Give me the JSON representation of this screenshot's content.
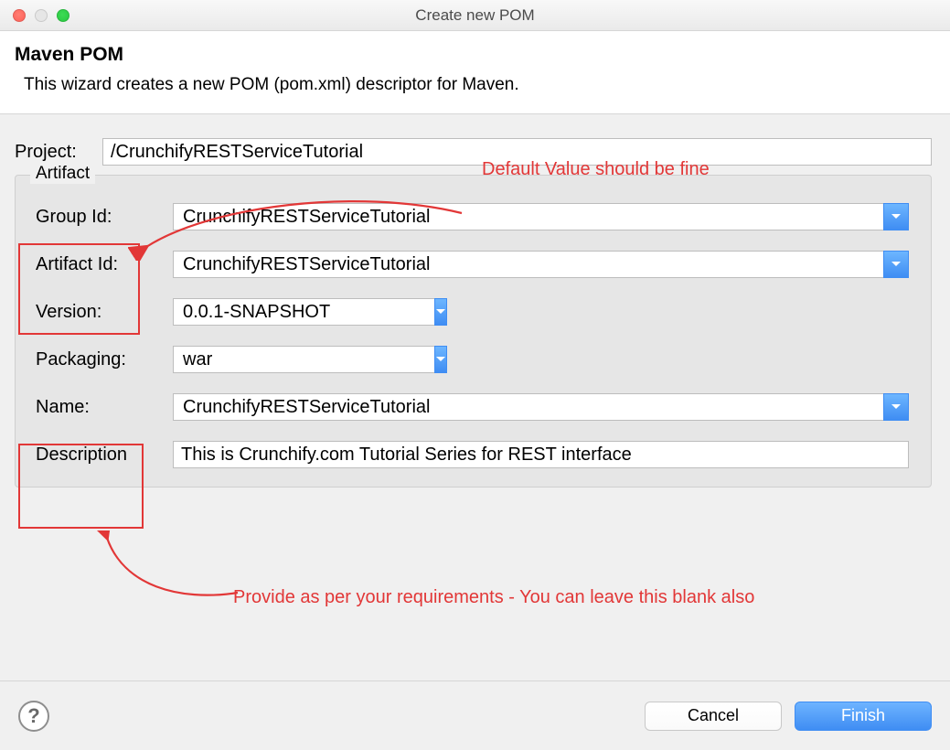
{
  "window": {
    "title": "Create new POM"
  },
  "header": {
    "title": "Maven POM",
    "description": "This wizard creates a new POM (pom.xml) descriptor for Maven."
  },
  "project": {
    "label": "Project:",
    "value": "/CrunchifyRESTServiceTutorial"
  },
  "artifact_section_label": "Artifact",
  "fields": {
    "group_id": {
      "label": "Group Id:",
      "value": "CrunchifyRESTServiceTutorial"
    },
    "artifact_id": {
      "label": "Artifact Id:",
      "value": "CrunchifyRESTServiceTutorial"
    },
    "version": {
      "label": "Version:",
      "value": "0.0.1-SNAPSHOT"
    },
    "packaging": {
      "label": "Packaging:",
      "value": "war"
    },
    "name": {
      "label": "Name:",
      "value": "CrunchifyRESTServiceTutorial"
    },
    "description": {
      "label": "Description",
      "value": "This is Crunchify.com Tutorial Series for REST interface"
    }
  },
  "annotations": {
    "top": "Default Value should be fine",
    "bottom": "Provide as per your requirements - You can leave this blank also"
  },
  "buttons": {
    "help": "?",
    "cancel": "Cancel",
    "finish": "Finish"
  }
}
